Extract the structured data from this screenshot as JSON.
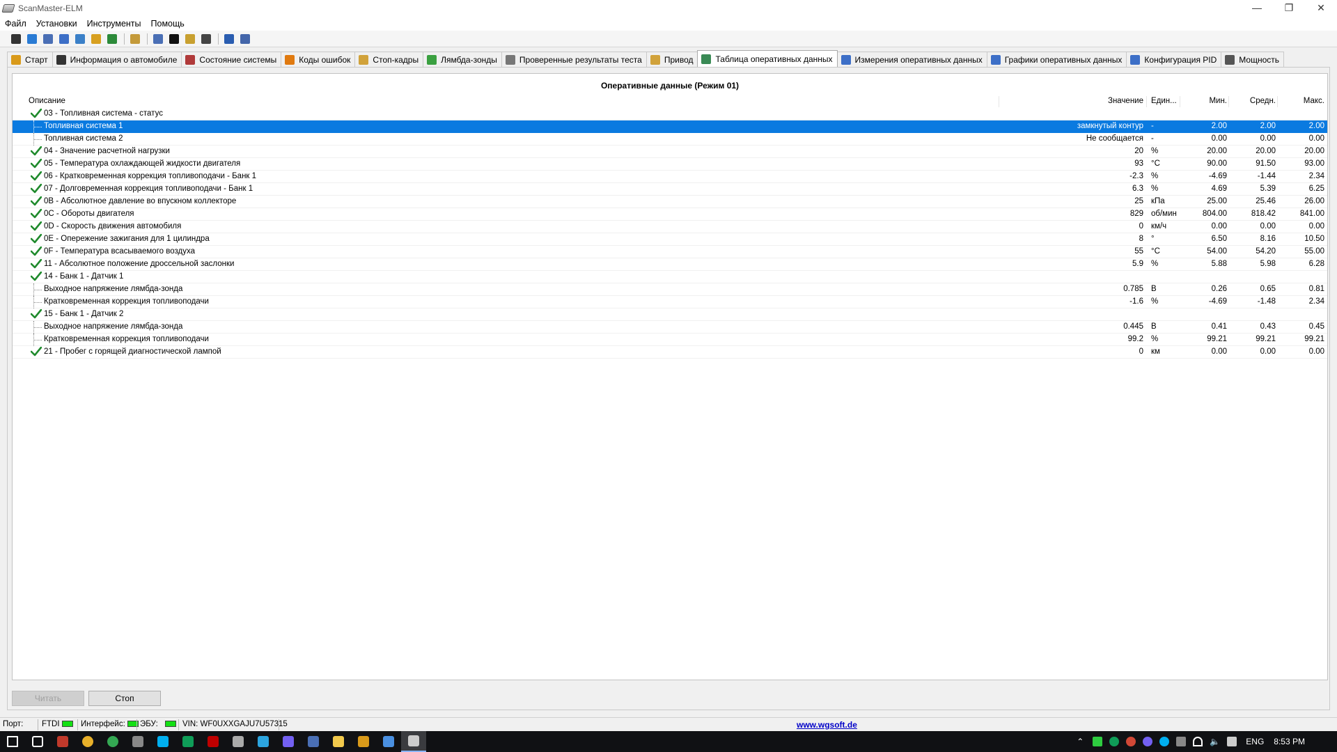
{
  "window": {
    "title": "ScanMaster-ELM",
    "minimize": "—",
    "restore": "❐",
    "close": "✕"
  },
  "menu": [
    "Файл",
    "Установки",
    "Инструменты",
    "Помощь"
  ],
  "toolbar_icons": [
    {
      "name": "connect-icon",
      "color": "#333333"
    },
    {
      "name": "globe-icon",
      "color": "#2a7bd4"
    },
    {
      "name": "document-icon",
      "color": "#4a6fb5"
    },
    {
      "name": "table-icon",
      "color": "#3d6fc7"
    },
    {
      "name": "chart-icon",
      "color": "#3b80c8"
    },
    {
      "name": "gauge-icon",
      "color": "#d8a020"
    },
    {
      "name": "fuel-icon",
      "color": "#2c8a3a"
    },
    {
      "name": "clipboard-icon",
      "color": "#c49a3a"
    },
    {
      "name": "monitor-icon",
      "color": "#4a6fb5"
    },
    {
      "name": "terminal-icon",
      "color": "#111111"
    },
    {
      "name": "battery-icon",
      "color": "#c8a030"
    },
    {
      "name": "disc-icon",
      "color": "#444444"
    },
    {
      "name": "info-icon",
      "color": "#2a5db0"
    },
    {
      "name": "book-icon",
      "color": "#4466aa"
    }
  ],
  "tabs": [
    {
      "label": "Старт",
      "icon": "start-icon",
      "color": "#d99a1a"
    },
    {
      "label": "Информация о автомобиле",
      "icon": "info-icon",
      "color": "#333333"
    },
    {
      "label": "Состояние системы",
      "icon": "system-icon",
      "color": "#b03a3a"
    },
    {
      "label": "Коды ошибок",
      "icon": "warning-icon",
      "color": "#e07a10"
    },
    {
      "label": "Стоп-кадры",
      "icon": "freeze-frame-icon",
      "color": "#d1a23a"
    },
    {
      "label": "Лямбда-зонды",
      "icon": "lambda-icon",
      "color": "#3aa040"
    },
    {
      "label": "Проверенные результаты теста",
      "icon": "gear-icon",
      "color": "#777777"
    },
    {
      "label": "Привод",
      "icon": "drive-icon",
      "color": "#d1a23a"
    },
    {
      "label": "Таблица оперативных данных",
      "icon": "table-icon",
      "color": "#3a8a55",
      "active": true
    },
    {
      "label": "Измерения оперативных данных",
      "icon": "grid-icon",
      "color": "#3d6fc7"
    },
    {
      "label": "Графики оперативных данных",
      "icon": "chart-icon",
      "color": "#3d6fc7"
    },
    {
      "label": "Конфигурация PID",
      "icon": "config-icon",
      "color": "#3d6fc7"
    },
    {
      "label": "Мощность",
      "icon": "power-icon",
      "color": "#555555"
    }
  ],
  "grid": {
    "title": "Оперативные данные (Режим 01)",
    "headers": {
      "description": "Описание",
      "value": "Значение",
      "unit": "Един...",
      "min": "Мин.",
      "avg": "Средн.",
      "max": "Макс."
    },
    "rows": [
      {
        "desc": "03 - Топливная система - статус",
        "type": "group"
      },
      {
        "desc": "Топливная система 1",
        "type": "child",
        "selected": true,
        "value": "замкнутый контур",
        "unit": "-",
        "min": "2.00",
        "avg": "2.00",
        "max": "2.00"
      },
      {
        "desc": "Топливная система 2",
        "type": "child",
        "value": "Не сообщается",
        "unit": "-",
        "min": "0.00",
        "avg": "0.00",
        "max": "0.00"
      },
      {
        "desc": "04 - Значение расчетной нагрузки",
        "type": "group",
        "value": "20",
        "unit": "%",
        "min": "20.00",
        "avg": "20.00",
        "max": "20.00"
      },
      {
        "desc": "05 - Температура охлаждающей жидкости двигателя",
        "type": "group",
        "value": "93",
        "unit": "°C",
        "min": "90.00",
        "avg": "91.50",
        "max": "93.00"
      },
      {
        "desc": "06 - Кратковременная коррекция топливоподачи - Банк 1",
        "type": "group",
        "value": "-2.3",
        "unit": "%",
        "min": "-4.69",
        "avg": "-1.44",
        "max": "2.34"
      },
      {
        "desc": "07 - Долговременная коррекция топливоподачи - Банк 1",
        "type": "group",
        "value": "6.3",
        "unit": "%",
        "min": "4.69",
        "avg": "5.39",
        "max": "6.25"
      },
      {
        "desc": "0B - Абсолютное давление во впускном коллекторе",
        "type": "group",
        "value": "25",
        "unit": "кПа",
        "min": "25.00",
        "avg": "25.46",
        "max": "26.00"
      },
      {
        "desc": "0C - Обороты двигателя",
        "type": "group",
        "value": "829",
        "unit": "об/мин",
        "min": "804.00",
        "avg": "818.42",
        "max": "841.00"
      },
      {
        "desc": "0D - Скорость движения автомобиля",
        "type": "group",
        "value": "0",
        "unit": "км/ч",
        "min": "0.00",
        "avg": "0.00",
        "max": "0.00"
      },
      {
        "desc": "0E - Опережение зажигания для 1 цилиндра",
        "type": "group",
        "value": "8",
        "unit": "°",
        "min": "6.50",
        "avg": "8.16",
        "max": "10.50"
      },
      {
        "desc": "0F - Температура всасываемого воздуха",
        "type": "group",
        "value": "55",
        "unit": "°C",
        "min": "54.00",
        "avg": "54.20",
        "max": "55.00"
      },
      {
        "desc": "11 - Абсолютное положение дроссельной заслонки",
        "type": "group",
        "value": "5.9",
        "unit": "%",
        "min": "5.88",
        "avg": "5.98",
        "max": "6.28"
      },
      {
        "desc": "14 - Банк 1 - Датчик 1",
        "type": "group"
      },
      {
        "desc": "Выходное напряжение лямбда-зонда",
        "type": "child",
        "value": "0.785",
        "unit": "В",
        "min": "0.26",
        "avg": "0.65",
        "max": "0.81"
      },
      {
        "desc": "Кратковременная коррекция топливоподачи",
        "type": "child",
        "value": "-1.6",
        "unit": "%",
        "min": "-4.69",
        "avg": "-1.48",
        "max": "2.34"
      },
      {
        "desc": "15 - Банк 1 - Датчик 2",
        "type": "group"
      },
      {
        "desc": "Выходное напряжение лямбда-зонда",
        "type": "child",
        "value": "0.445",
        "unit": "В",
        "min": "0.41",
        "avg": "0.43",
        "max": "0.45"
      },
      {
        "desc": "Кратковременная коррекция топливоподачи",
        "type": "child",
        "value": "99.2",
        "unit": "%",
        "min": "99.21",
        "avg": "99.21",
        "max": "99.21"
      },
      {
        "desc": "21 - Пробег с горящей диагностической лампой",
        "type": "group",
        "value": "0",
        "unit": "км",
        "min": "0.00",
        "avg": "0.00",
        "max": "0.00"
      }
    ]
  },
  "buttons": {
    "read": "Читать",
    "stop": "Стоп"
  },
  "status": {
    "port_label": "Порт:",
    "port_value": "FTDI",
    "interface_label": "Интерфейс:",
    "ecu_label": "ЭБУ:",
    "vin": "VIN: WF0UXXGAJU7U57315",
    "website": "www.wgsoft.de",
    "led_color": "#14e014"
  },
  "taskbar": {
    "apps": [
      {
        "name": "start-icon",
        "color": "#ffffff"
      },
      {
        "name": "task-view-icon",
        "color": "#ffffff"
      },
      {
        "name": "app-icon",
        "color": "#c0392b"
      },
      {
        "name": "chrome-icon",
        "color": "#e8b02a"
      },
      {
        "name": "chrome-icon",
        "color": "#34a853"
      },
      {
        "name": "app-icon",
        "color": "#888888"
      },
      {
        "name": "skype-icon",
        "color": "#00aff0"
      },
      {
        "name": "hangouts-icon",
        "color": "#0f9d58"
      },
      {
        "name": "filezilla-icon",
        "color": "#bf0000"
      },
      {
        "name": "app-icon",
        "color": "#aaaaaa"
      },
      {
        "name": "telegram-icon",
        "color": "#2ca5e0"
      },
      {
        "name": "viber-icon",
        "color": "#7360f2"
      },
      {
        "name": "app-icon",
        "color": "#4a6fb5"
      },
      {
        "name": "folder-icon",
        "color": "#f2c94c"
      },
      {
        "name": "app-icon",
        "color": "#d99a1a"
      },
      {
        "name": "app-icon",
        "color": "#4a90e2"
      },
      {
        "name": "scanmaster-icon",
        "color": "#cccccc",
        "active": true
      }
    ],
    "lang": "ENG",
    "time": "8:53 PM"
  }
}
